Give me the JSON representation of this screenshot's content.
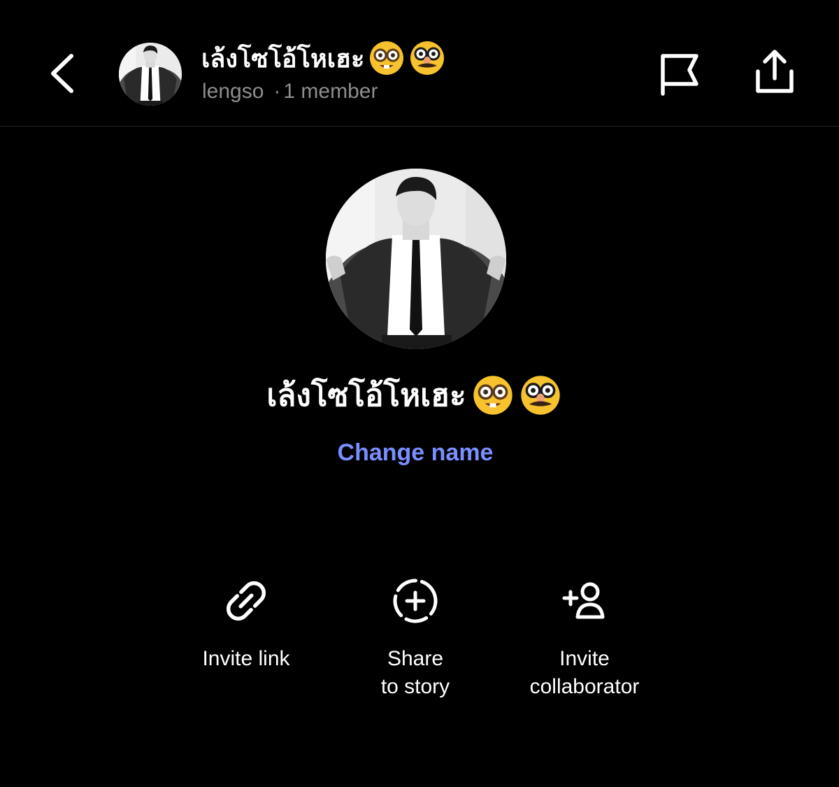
{
  "header": {
    "back_icon": "chevron-left-icon",
    "title": "เล้งโซโอ้โหเฮะ",
    "emoji_1": "nerd-face-emoji",
    "emoji_2": "disguised-face-emoji",
    "username": "lengso",
    "separator": "·",
    "member_count": "1 member",
    "flag_icon": "flag-icon",
    "share_icon": "share-icon"
  },
  "profile": {
    "title": "เล้งโซโอ้โหเฮะ",
    "change_name_label": "Change name",
    "link_color": "#7a8fff"
  },
  "actions": [
    {
      "label_line1": "Invite link",
      "label_line2": "",
      "icon": "link-icon"
    },
    {
      "label_line1": "Share",
      "label_line2": "to story",
      "icon": "story-add-icon"
    },
    {
      "label_line1": "Invite",
      "label_line2": "collaborator",
      "icon": "add-person-icon"
    }
  ]
}
